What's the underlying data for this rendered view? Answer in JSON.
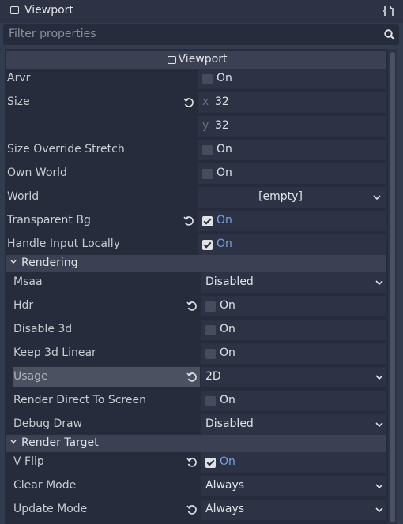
{
  "header": {
    "title": "Viewport"
  },
  "filter": {
    "placeholder": "Filter properties"
  },
  "section": {
    "title": "Viewport"
  },
  "props": {
    "arvr": {
      "label": "Arvr",
      "value": "On"
    },
    "size": {
      "label": "Size",
      "x_axis": "x",
      "x": "32",
      "y_axis": "y",
      "y": "32"
    },
    "size_override": {
      "label": "Size Override Stretch",
      "value": "On"
    },
    "own_world": {
      "label": "Own World",
      "value": "On"
    },
    "world": {
      "label": "World",
      "value": "[empty]"
    },
    "transparent_bg": {
      "label": "Transparent Bg",
      "value": "On"
    },
    "handle_input": {
      "label": "Handle Input Locally",
      "value": "On"
    }
  },
  "rendering": {
    "title": "Rendering",
    "msaa": {
      "label": "Msaa",
      "value": "Disabled"
    },
    "hdr": {
      "label": "Hdr",
      "value": "On"
    },
    "disable_3d": {
      "label": "Disable 3d",
      "value": "On"
    },
    "keep_3d_linear": {
      "label": "Keep 3d Linear",
      "value": "On"
    },
    "usage": {
      "label": "Usage",
      "value": "2D"
    },
    "render_direct": {
      "label": "Render Direct To Screen",
      "value": "On"
    },
    "debug_draw": {
      "label": "Debug Draw",
      "value": "Disabled"
    }
  },
  "render_target": {
    "title": "Render Target",
    "v_flip": {
      "label": "V Flip",
      "value": "On"
    },
    "clear_mode": {
      "label": "Clear Mode",
      "value": "Always"
    },
    "update_mode": {
      "label": "Update Mode",
      "value": "Always"
    }
  }
}
